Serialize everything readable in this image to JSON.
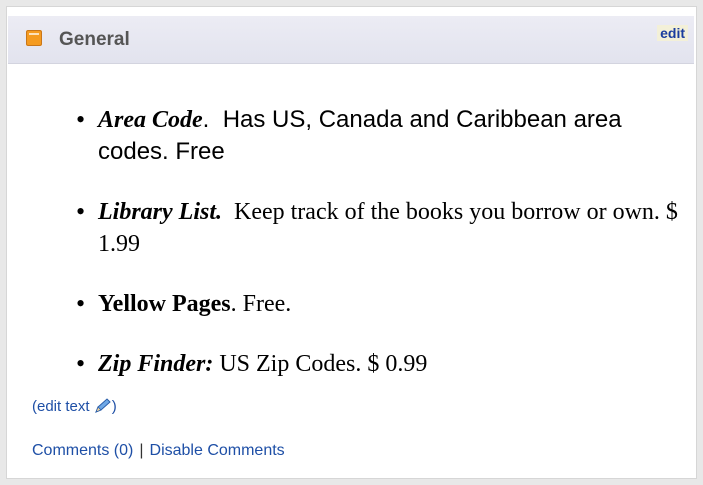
{
  "header": {
    "title": "General",
    "edit_label": "edit"
  },
  "items": [
    {
      "name": "Area Code",
      "suffix": ".",
      "desc": "Has US, Canada and Caribbean area codes. Free"
    },
    {
      "name": "Library List.",
      "desc": "Keep track of the books you borrow or own.  $ 1.99"
    },
    {
      "name": "Yellow Pages",
      "suffix": ".",
      "desc": "Free."
    },
    {
      "name": "Zip Finder:",
      "desc": "US Zip Codes. $ 0.99"
    }
  ],
  "edit_text": {
    "open": "(edit text ",
    "close": ")",
    "icon": "pencil-icon"
  },
  "footer": {
    "comments": "Comments (0)",
    "separator": "|",
    "disable": "Disable Comments"
  },
  "colors": {
    "link": "#1e4fa6",
    "header_bg": "#e4e5ef",
    "feed_icon": "#f59b20"
  }
}
